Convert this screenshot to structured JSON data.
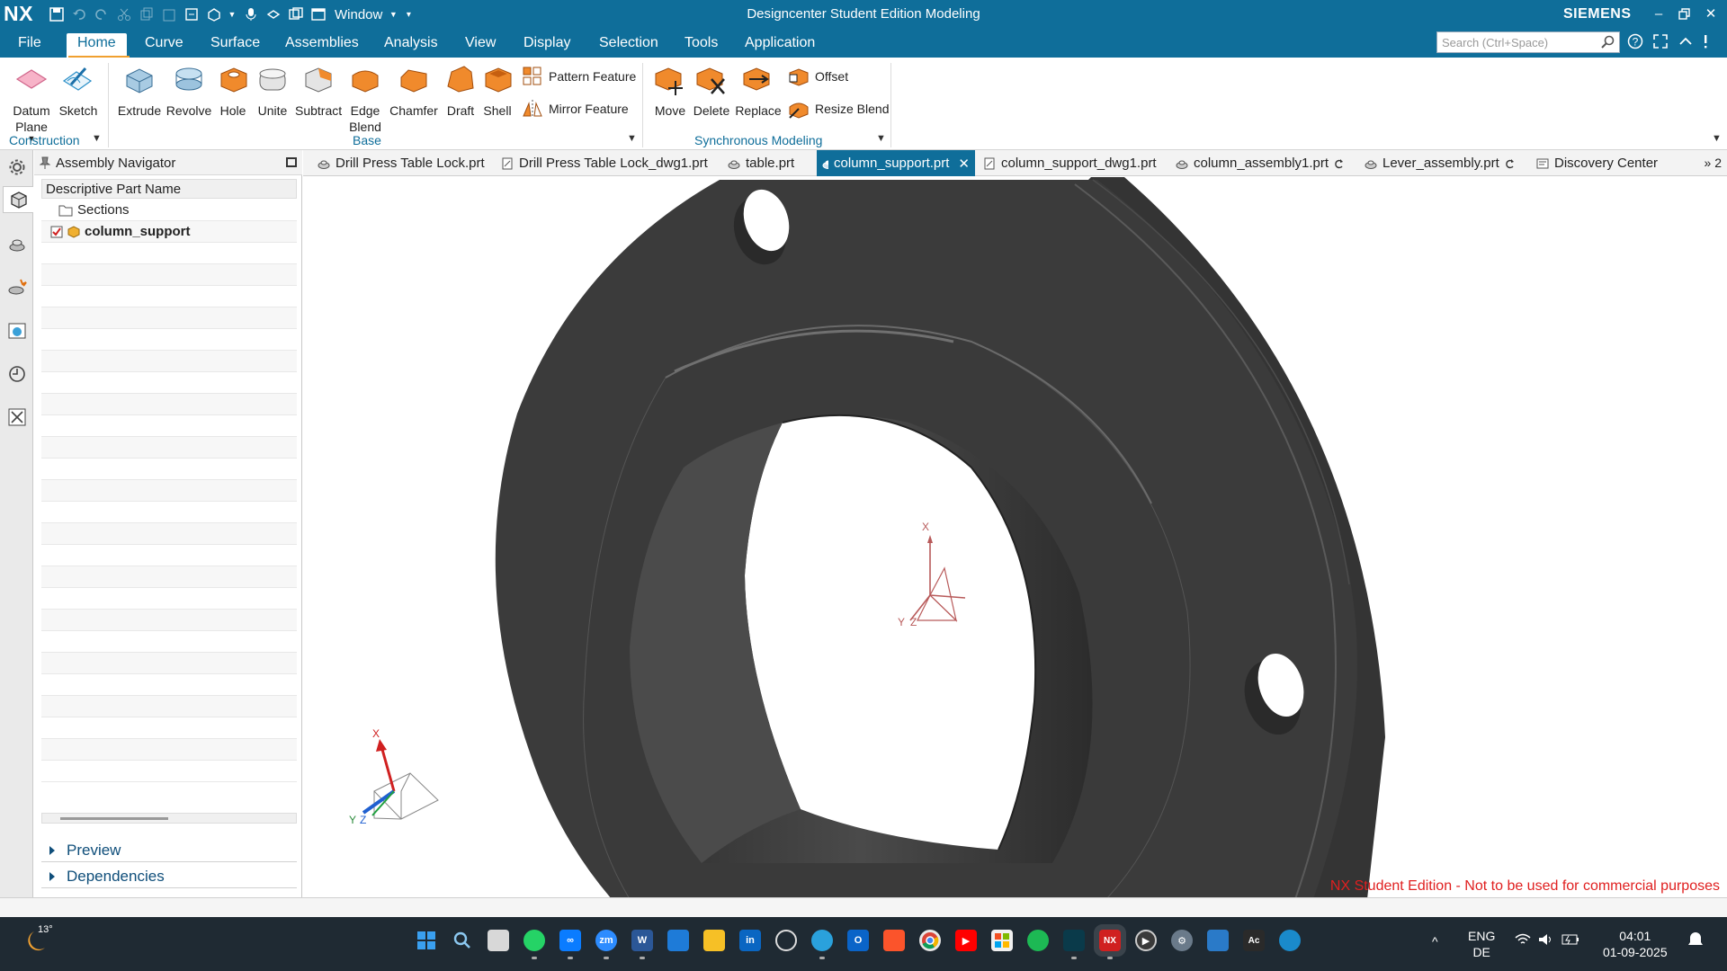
{
  "window": {
    "app_logo": "NX",
    "title": "Designcenter Student Edition Modeling",
    "brand": "SIEMENS",
    "window_menu": "Window"
  },
  "menu": {
    "items": [
      "File",
      "Home",
      "Curve",
      "Surface",
      "Assemblies",
      "Analysis",
      "View",
      "Display",
      "Selection",
      "Tools",
      "Application"
    ],
    "active": "Home",
    "search_placeholder": "Search (Ctrl+Space)"
  },
  "ribbon": {
    "construction": {
      "label": "Construction",
      "datum_plane": "Datum Plane",
      "sketch": "Sketch"
    },
    "base": {
      "label": "Base",
      "extrude": "Extrude",
      "revolve": "Revolve",
      "hole": "Hole",
      "unite": "Unite",
      "subtract": "Subtract",
      "edge_blend": "Edge Blend",
      "chamfer": "Chamfer",
      "draft": "Draft",
      "shell": "Shell",
      "pattern_feature": "Pattern Feature",
      "mirror_feature": "Mirror Feature"
    },
    "sync": {
      "label": "Synchronous Modeling",
      "move": "Move",
      "delete": "Delete",
      "replace": "Replace",
      "offset": "Offset",
      "resize_blend": "Resize Blend"
    }
  },
  "navigator": {
    "title": "Assembly Navigator",
    "column_header": "Descriptive Part Name",
    "rows": [
      "Sections",
      "column_support"
    ],
    "panels": [
      "Preview",
      "Dependencies"
    ]
  },
  "tabs": {
    "items": [
      {
        "label": "Drill Press Table Lock.prt"
      },
      {
        "label": "Drill Press Table Lock_dwg1.prt"
      },
      {
        "label": "table.prt"
      },
      {
        "label": "column_support.prt"
      },
      {
        "label": "column_support_dwg1.prt"
      },
      {
        "label": "column_assembly1.prt"
      },
      {
        "label": "Lever_assembly.prt"
      },
      {
        "label": "Discovery Center"
      }
    ],
    "active": "column_support.prt",
    "overflow": "» 2"
  },
  "graphics": {
    "watermark": "NX Student Edition - Not to be used for commercial purposes",
    "wcs_axes": [
      "X",
      "Y",
      "Z"
    ],
    "csys_axes": [
      "X",
      "Y",
      "Z"
    ]
  },
  "taskbar": {
    "temperature": "13°",
    "language": "ENG",
    "layout": "DE",
    "time": "04:01",
    "date": "01-09-2025"
  }
}
